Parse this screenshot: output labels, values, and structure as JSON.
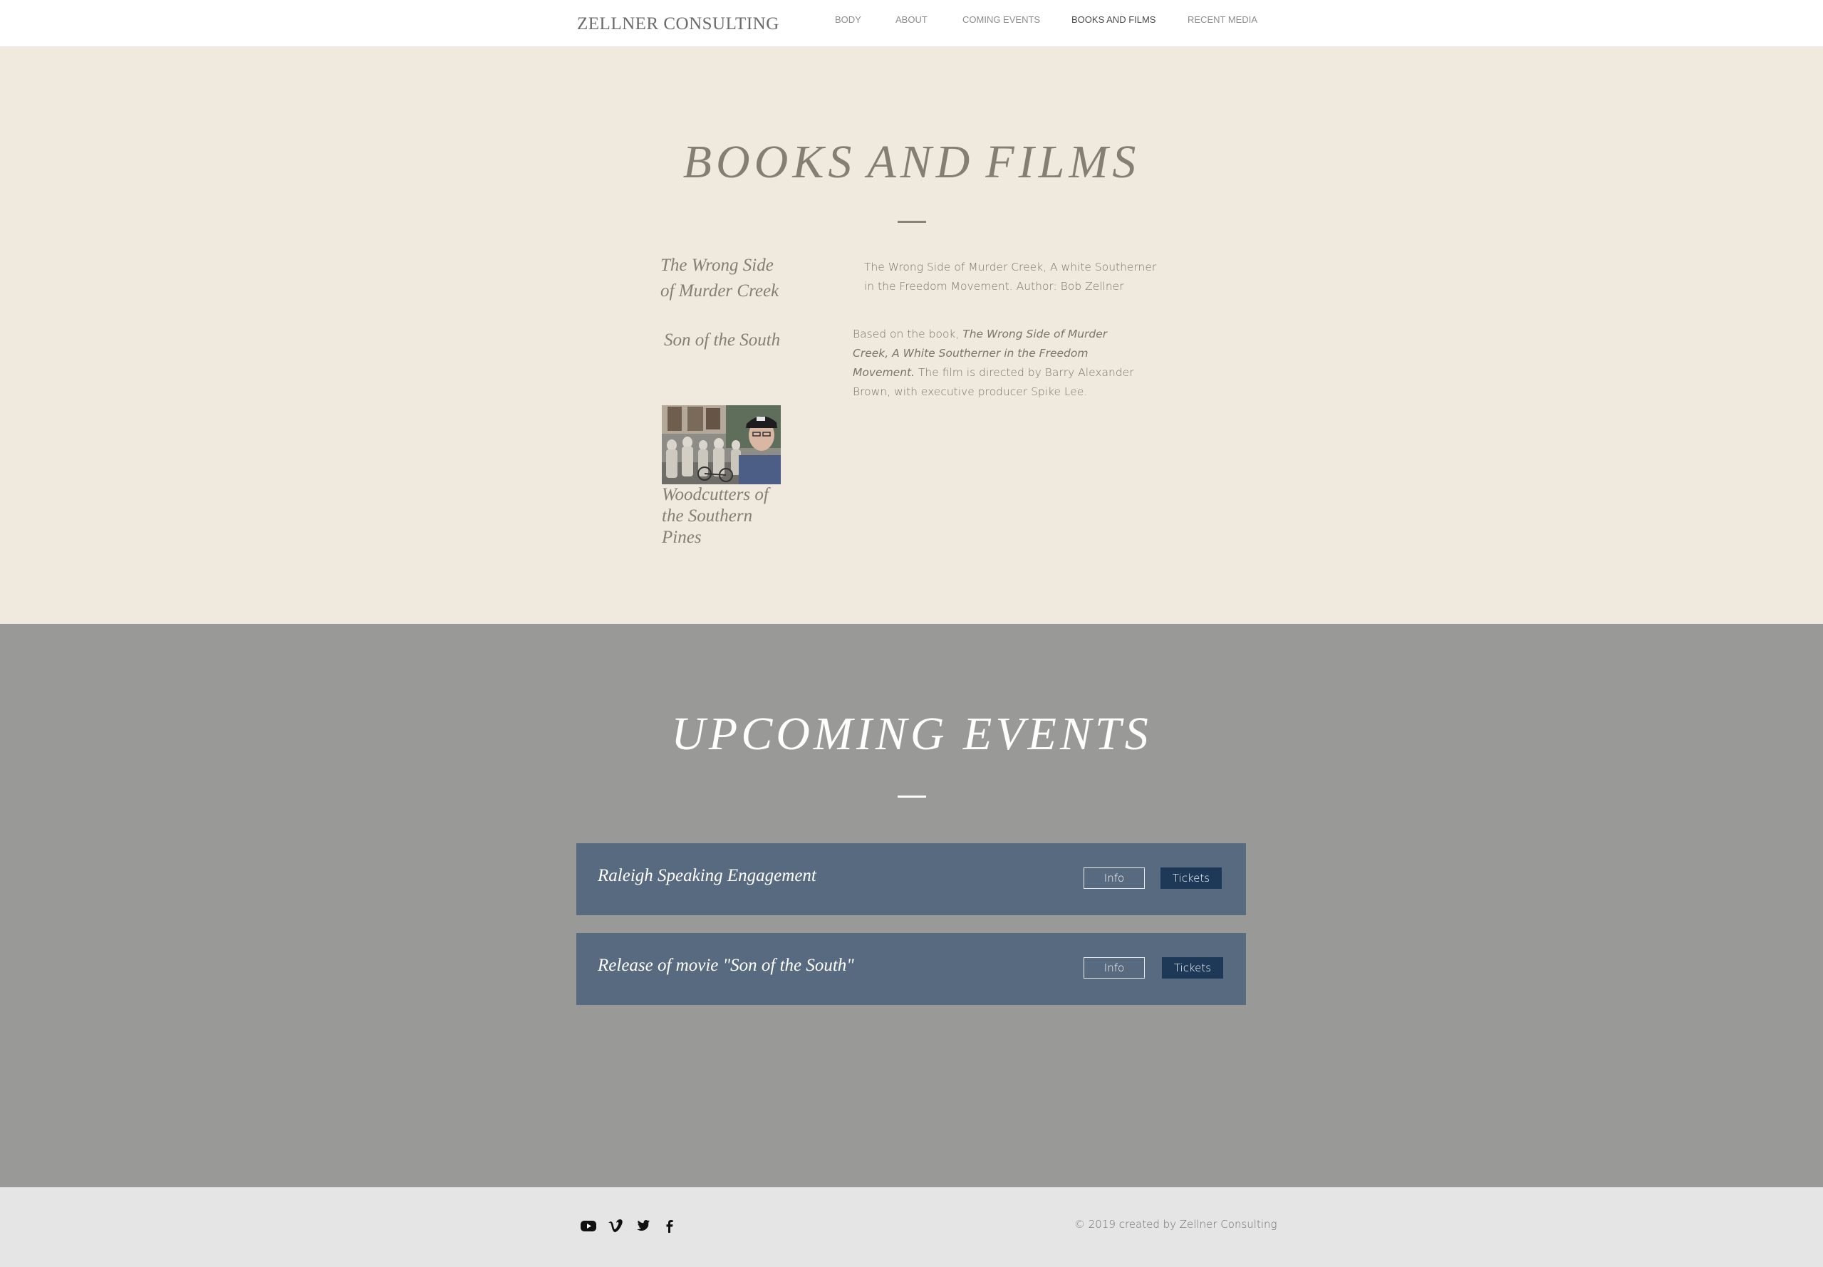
{
  "header": {
    "brand": "ZELLNER CONSULTING",
    "nav": [
      "BODY",
      "ABOUT",
      "COMING EVENTS",
      "BOOKS AND FILMS",
      "RECENT MEDIA"
    ],
    "active": "BOOKS AND FILMS"
  },
  "books": {
    "title_word1": "BOOKS",
    "title_word2": "AND",
    "title_word3": "FILMS",
    "items": [
      {
        "heading_line1": "The Wrong Side",
        "heading_line2": "of Murder Creek",
        "description": "The Wrong Side of Murder Creek, A white Southerner in the Freedom Movement. Author: Bob Zellner"
      },
      {
        "heading": "Son of the South",
        "desc_prefix": "Based on the book, ",
        "desc_italic": "The Wrong Side of Murder Creek, A White Southerner in the Freedom Movement.",
        "desc_suffix": "  The film is directed by Barry Alexander Brown, with executive producer Spike Lee."
      },
      {
        "heading": "Woodcutters of the Southern Pines"
      }
    ]
  },
  "events": {
    "title": "UPCOMING EVENTS",
    "list": [
      {
        "title": "Raleigh Speaking Engagement",
        "info": "Info",
        "tickets": "Tickets"
      },
      {
        "title": "Release of movie  \"Son of the South\"",
        "info": "Info",
        "tickets": "Tickets"
      }
    ]
  },
  "footer": {
    "social": [
      "youtube-icon",
      "vimeo-icon",
      "twitter-icon",
      "facebook-icon"
    ],
    "copyright": "© 2019 created by Zellner Consulting"
  },
  "colors": {
    "cream": "#f0e9dd",
    "gray": "#999998",
    "event_bg": "#586a80",
    "tickets_bg": "#1e3958",
    "footer_bg": "#e6e5e5"
  }
}
